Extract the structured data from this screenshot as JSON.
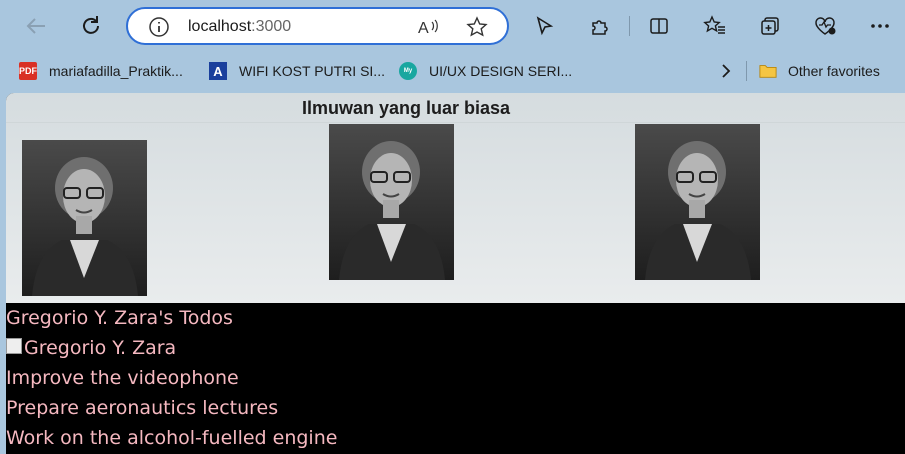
{
  "browser": {
    "url_host": "localhost",
    "url_port": ":3000",
    "bookmarks": [
      {
        "label": "mariafadilla_Praktik...",
        "icon": "pdf-icon"
      },
      {
        "label": "WIFI KOST PUTRI SI...",
        "icon": "a-letter-icon"
      },
      {
        "label": "UI/UX DESIGN SERI...",
        "icon": "myskill-icon"
      }
    ],
    "other_favorites": "Other favorites"
  },
  "gallery": {
    "title": "Ilmuwan yang luar biasa",
    "images": [
      "scientist-portrait-1",
      "scientist-portrait-2",
      "scientist-portrait-3"
    ]
  },
  "todos": {
    "heading": "Gregorio Y. Zara's Todos",
    "avatar_alt": "Gregorio Y. Zara",
    "items": [
      "Improve the videophone",
      "Prepare aeronautics lectures",
      "Work on the alcohol-fuelled engine"
    ]
  },
  "colors": {
    "todo_text": "#f5b8c0",
    "page_bg": "#000000",
    "chrome": "#a9c6de"
  }
}
